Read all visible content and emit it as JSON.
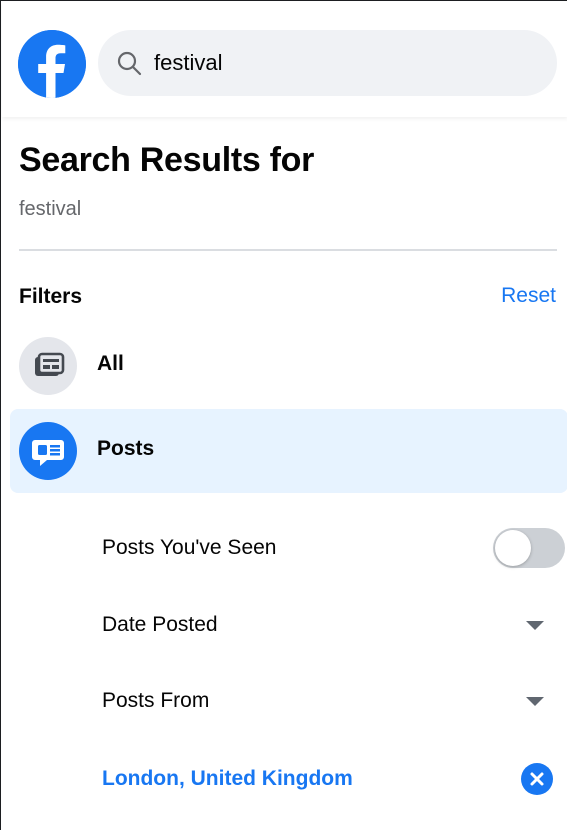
{
  "header": {
    "search_value": "festival"
  },
  "heading": {
    "title": "Search Results for",
    "query": "festival"
  },
  "filters": {
    "heading": "Filters",
    "reset_label": "Reset",
    "items": [
      {
        "label": "All",
        "icon": "all-results-icon",
        "selected": false
      },
      {
        "label": "Posts",
        "icon": "posts-icon",
        "selected": true
      }
    ],
    "sub_filters": {
      "seen_label": "Posts You've Seen",
      "seen_on": false,
      "date_label": "Date Posted",
      "from_label": "Posts From",
      "location_label": "London, United Kingdom"
    }
  },
  "colors": {
    "accent": "#1877f2",
    "selected_bg": "#e7f3ff",
    "muted_text": "#65676b"
  }
}
